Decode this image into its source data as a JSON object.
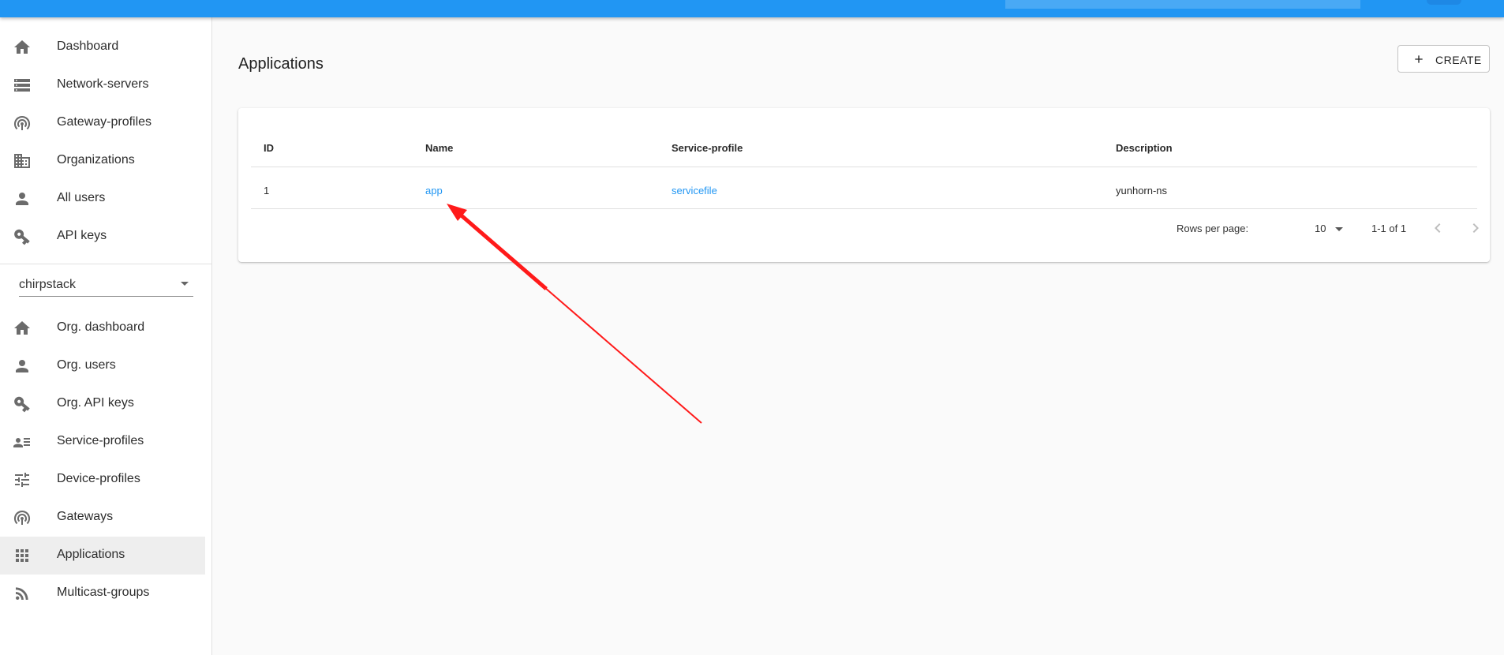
{
  "colors": {
    "topbar": "#2196f3",
    "link": "#2196f3",
    "annotation": "#ff1a1a"
  },
  "admin_nav": [
    {
      "label": "Dashboard",
      "icon": "home-icon"
    },
    {
      "label": "Network-servers",
      "icon": "server-icon"
    },
    {
      "label": "Gateway-profiles",
      "icon": "access-point-icon"
    },
    {
      "label": "Organizations",
      "icon": "domain-icon"
    },
    {
      "label": "All users",
      "icon": "account-icon"
    },
    {
      "label": "API keys",
      "icon": "key-icon"
    }
  ],
  "org_select": {
    "value": "chirpstack"
  },
  "org_nav": [
    {
      "label": "Org. dashboard",
      "icon": "home-icon"
    },
    {
      "label": "Org. users",
      "icon": "account-icon"
    },
    {
      "label": "Org. API keys",
      "icon": "key-icon"
    },
    {
      "label": "Service-profiles",
      "icon": "account-details-icon"
    },
    {
      "label": "Device-profiles",
      "icon": "tune-icon"
    },
    {
      "label": "Gateways",
      "icon": "access-point-icon"
    },
    {
      "label": "Applications",
      "icon": "apps-icon",
      "active": true
    },
    {
      "label": "Multicast-groups",
      "icon": "rss-icon"
    }
  ],
  "page": {
    "title": "Applications",
    "create_label": "CREATE"
  },
  "table": {
    "columns": [
      "ID",
      "Name",
      "Service-profile",
      "Description"
    ],
    "rows": [
      {
        "id": "1",
        "name": "app",
        "service_profile": "servicefile",
        "description": "yunhorn-ns"
      }
    ]
  },
  "pagination": {
    "rows_per_page_label": "Rows per page:",
    "rows_per_page": "10",
    "range": "1-1 of 1"
  }
}
